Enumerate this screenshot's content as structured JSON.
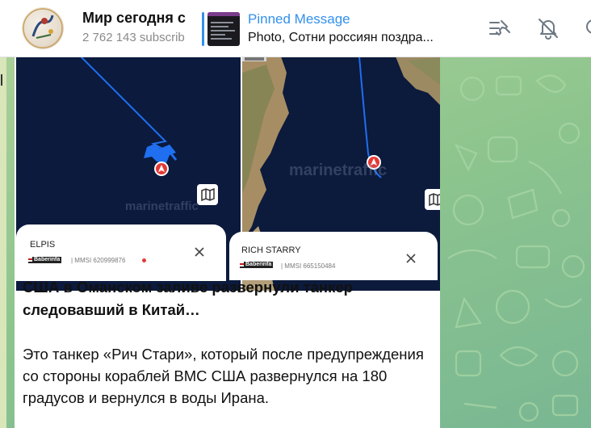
{
  "header": {
    "channel_title": "Мир сегодня с",
    "subscribers": "2 762 143 subscrib",
    "pinned_label": "Pinned Message",
    "pinned_text": "Photo, Сотни россиян поздра...",
    "icons": [
      "pinned-list-icon",
      "mute-bell-icon"
    ]
  },
  "map1": {
    "watermark": "marinetraffic",
    "ship_name": "ELPIS",
    "provider": "Baberinfa",
    "mmsi": "| MMSI 620999876"
  },
  "map2": {
    "watermark": "marinetraffic",
    "ship_name": "RICH STARRY",
    "provider": "Baberinfa",
    "mmsi": "| MMSI 665150484"
  },
  "post": {
    "headline": "США в Оманском заливе развернули танкер следовавший в Китай…",
    "body": "Это танкер «Рич Стари», который после предупреждения со стороны кораблей ВМС США развернулся на 180 градусов и вернулся в воды Ирана."
  },
  "colors": {
    "accent": "#3390ec",
    "sea": "#0b1a3d",
    "track": "#1f6ff0",
    "chat_background": "#8ec58e"
  }
}
